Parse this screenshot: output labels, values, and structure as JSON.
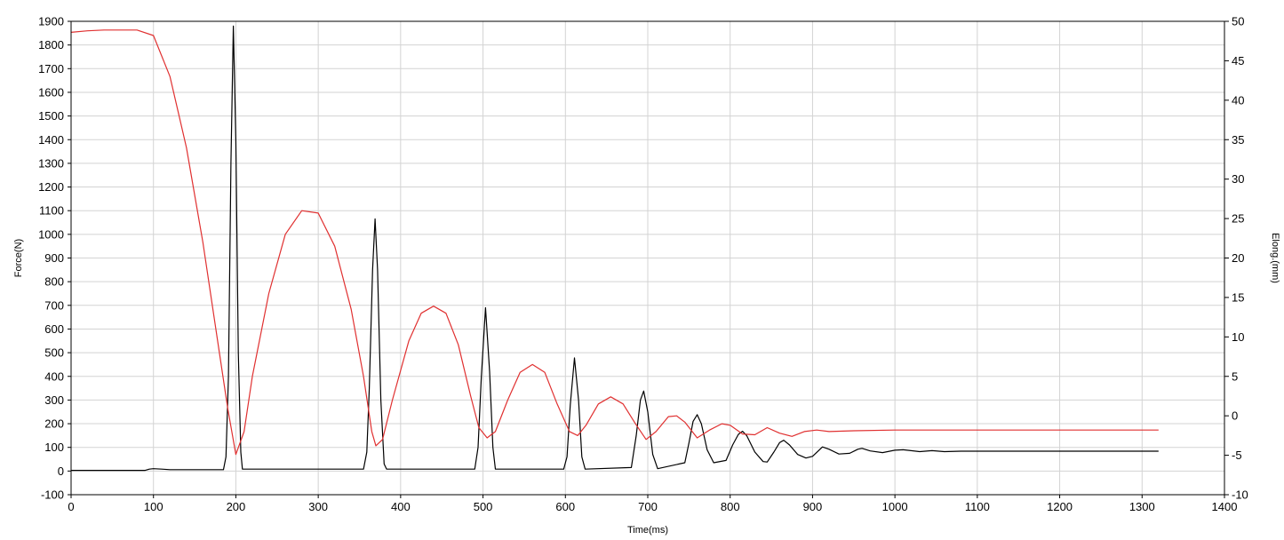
{
  "chart_data": {
    "type": "line",
    "title": "",
    "xlabel": "Time(ms)",
    "ylabel": "Force(N)",
    "y2label": "Elong.(mm)",
    "xlim": [
      0,
      1400
    ],
    "ylim": [
      -100,
      1900
    ],
    "y2lim": [
      -10,
      50
    ],
    "grid": true,
    "x_ticks": [
      0,
      100,
      200,
      300,
      400,
      500,
      600,
      700,
      800,
      900,
      1000,
      1100,
      1200,
      1300,
      1400
    ],
    "y_ticks": [
      -100,
      0,
      100,
      200,
      300,
      400,
      500,
      600,
      700,
      800,
      900,
      1000,
      1100,
      1200,
      1300,
      1400,
      1500,
      1600,
      1700,
      1800,
      1900
    ],
    "y2_ticks": [
      -10,
      -5,
      0,
      5,
      10,
      15,
      20,
      25,
      30,
      35,
      40,
      45,
      50
    ],
    "series": [
      {
        "axis": "left",
        "color": "#000000",
        "points": [
          [
            0,
            3
          ],
          [
            90,
            3
          ],
          [
            95,
            8
          ],
          [
            100,
            10
          ],
          [
            110,
            8
          ],
          [
            120,
            6
          ],
          [
            150,
            6
          ],
          [
            185,
            6
          ],
          [
            188,
            60
          ],
          [
            191,
            400
          ],
          [
            194,
            1300
          ],
          [
            197,
            1880
          ],
          [
            200,
            1400
          ],
          [
            203,
            500
          ],
          [
            206,
            80
          ],
          [
            208,
            8
          ],
          [
            355,
            8
          ],
          [
            359,
            80
          ],
          [
            362,
            350
          ],
          [
            366,
            850
          ],
          [
            369,
            1065
          ],
          [
            372,
            850
          ],
          [
            376,
            300
          ],
          [
            380,
            30
          ],
          [
            383,
            8
          ],
          [
            490,
            8
          ],
          [
            494,
            100
          ],
          [
            498,
            400
          ],
          [
            503,
            690
          ],
          [
            508,
            420
          ],
          [
            512,
            100
          ],
          [
            515,
            8
          ],
          [
            598,
            8
          ],
          [
            602,
            60
          ],
          [
            606,
            280
          ],
          [
            611,
            478
          ],
          [
            616,
            300
          ],
          [
            620,
            60
          ],
          [
            624,
            8
          ],
          [
            680,
            15
          ],
          [
            686,
            150
          ],
          [
            691,
            300
          ],
          [
            695,
            338
          ],
          [
            700,
            250
          ],
          [
            706,
            70
          ],
          [
            712,
            10
          ],
          [
            745,
            35
          ],
          [
            750,
            120
          ],
          [
            755,
            210
          ],
          [
            760,
            238
          ],
          [
            765,
            200
          ],
          [
            772,
            90
          ],
          [
            780,
            35
          ],
          [
            795,
            45
          ],
          [
            803,
            110
          ],
          [
            810,
            155
          ],
          [
            815,
            168
          ],
          [
            820,
            150
          ],
          [
            830,
            80
          ],
          [
            840,
            40
          ],
          [
            845,
            38
          ],
          [
            853,
            80
          ],
          [
            860,
            120
          ],
          [
            865,
            130
          ],
          [
            872,
            110
          ],
          [
            882,
            70
          ],
          [
            892,
            55
          ],
          [
            900,
            62
          ],
          [
            907,
            85
          ],
          [
            912,
            102
          ],
          [
            920,
            92
          ],
          [
            932,
            72
          ],
          [
            945,
            75
          ],
          [
            955,
            92
          ],
          [
            960,
            96
          ],
          [
            970,
            85
          ],
          [
            985,
            78
          ],
          [
            1000,
            88
          ],
          [
            1010,
            90
          ],
          [
            1030,
            82
          ],
          [
            1045,
            86
          ],
          [
            1060,
            82
          ],
          [
            1080,
            84
          ],
          [
            1100,
            84
          ],
          [
            1200,
            84
          ],
          [
            1320,
            84
          ]
        ]
      },
      {
        "axis": "right",
        "color": "#e03030",
        "points": [
          [
            0,
            48.6
          ],
          [
            20,
            48.8
          ],
          [
            40,
            48.9
          ],
          [
            80,
            48.9
          ],
          [
            100,
            48.2
          ],
          [
            120,
            43
          ],
          [
            140,
            34
          ],
          [
            160,
            22
          ],
          [
            180,
            8
          ],
          [
            190,
            1
          ],
          [
            200,
            -4.9
          ],
          [
            210,
            -2
          ],
          [
            220,
            5
          ],
          [
            240,
            15.5
          ],
          [
            260,
            23
          ],
          [
            280,
            26
          ],
          [
            300,
            25.7
          ],
          [
            320,
            21.5
          ],
          [
            340,
            13.5
          ],
          [
            355,
            5
          ],
          [
            365,
            -2
          ],
          [
            370,
            -3.8
          ],
          [
            378,
            -3
          ],
          [
            390,
            2
          ],
          [
            410,
            9.5
          ],
          [
            425,
            13
          ],
          [
            440,
            13.9
          ],
          [
            455,
            13
          ],
          [
            470,
            9
          ],
          [
            485,
            2.5
          ],
          [
            495,
            -1.5
          ],
          [
            505,
            -2.8
          ],
          [
            515,
            -2
          ],
          [
            530,
            2
          ],
          [
            545,
            5.5
          ],
          [
            560,
            6.5
          ],
          [
            575,
            5.5
          ],
          [
            590,
            1.5
          ],
          [
            605,
            -2
          ],
          [
            615,
            -2.5
          ],
          [
            625,
            -1.2
          ],
          [
            640,
            1.5
          ],
          [
            655,
            2.4
          ],
          [
            670,
            1.5
          ],
          [
            685,
            -1
          ],
          [
            698,
            -3
          ],
          [
            710,
            -2
          ],
          [
            725,
            -0.1
          ],
          [
            735,
            0
          ],
          [
            745,
            -0.8
          ],
          [
            760,
            -2.8
          ],
          [
            775,
            -1.8
          ],
          [
            790,
            -1
          ],
          [
            800,
            -1.2
          ],
          [
            815,
            -2.3
          ],
          [
            830,
            -2.4
          ],
          [
            845,
            -1.5
          ],
          [
            860,
            -2.2
          ],
          [
            875,
            -2.6
          ],
          [
            890,
            -2
          ],
          [
            905,
            -1.8
          ],
          [
            920,
            -2
          ],
          [
            950,
            -1.9
          ],
          [
            1000,
            -1.8
          ],
          [
            1100,
            -1.8
          ],
          [
            1200,
            -1.8
          ],
          [
            1320,
            -1.8
          ]
        ]
      }
    ]
  }
}
